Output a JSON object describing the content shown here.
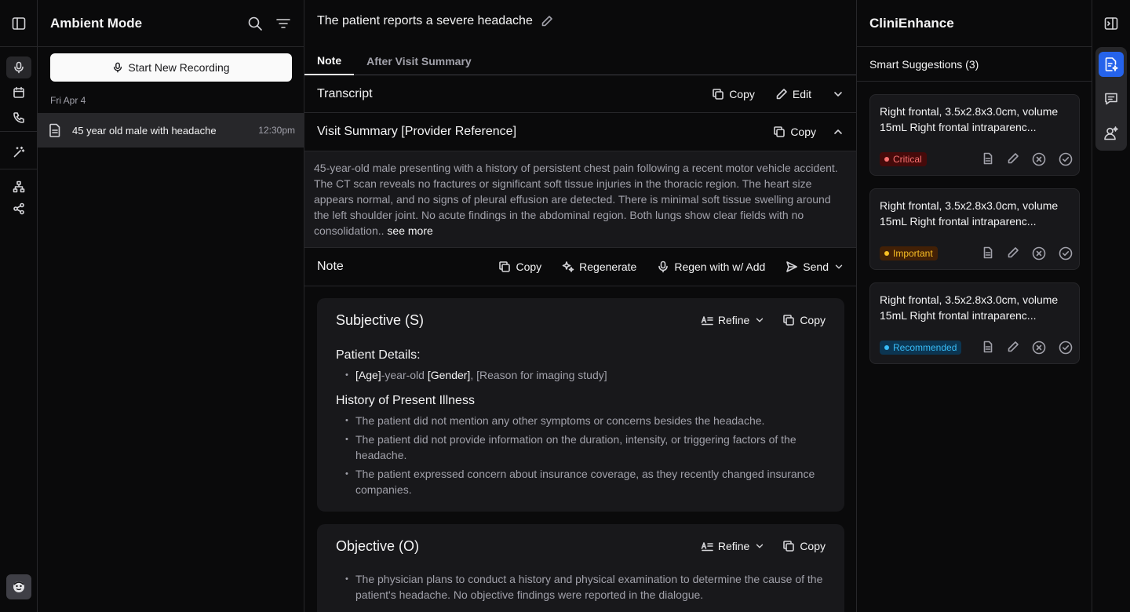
{
  "sessions": {
    "title": "Ambient Mode",
    "record_button": "Start New Recording",
    "date_group": "Fri Apr 4",
    "items": [
      {
        "name": "45 year old male with headache",
        "time": "12:30pm"
      }
    ]
  },
  "note": {
    "title": "The patient reports a severe headache",
    "tabs": [
      {
        "label": "Note"
      },
      {
        "label": "After Visit Summary"
      }
    ],
    "transcript": {
      "label": "Transcript",
      "copy": "Copy",
      "edit": "Edit"
    },
    "visit_summary": {
      "label": "Visit Summary [Provider Reference]",
      "copy": "Copy",
      "text": "45-year-old male presenting with a history of persistent chest pain following a recent motor vehicle accident. The CT scan reveals no fractures or significant soft tissue injuries in the thoracic region. The heart size appears normal, and no signs of pleural effusion are detected. There is minimal soft tissue swelling around the left shoulder joint. No acute findings in the abdominal region. Both lungs show clear fields with no consolidation..",
      "see_more": "see more"
    },
    "note_bar": {
      "label": "Note",
      "copy": "Copy",
      "regenerate": "Regenerate",
      "regen_add": "Regen with w/ Add",
      "send": "Send"
    },
    "subjective": {
      "title": "Subjective (S)",
      "refine": "Refine",
      "copy": "Copy",
      "patient_details_heading": "Patient Details:",
      "pd_age": "[Age]",
      "pd_year_old": "-year-old ",
      "pd_gender": "[Gender]",
      "pd_reason": ", [Reason for imaging study]",
      "hpi_heading": "History of Present Illness",
      "hpi": [
        "The patient did not mention any other symptoms or concerns besides the headache.",
        "The patient did not provide information on the duration, intensity, or triggering factors of the headache.",
        "The patient expressed concern about insurance coverage, as they recently changed insurance companies."
      ]
    },
    "objective": {
      "title": "Objective (O)",
      "refine": "Refine",
      "copy": "Copy",
      "items": [
        "The physician plans to conduct a history and physical examination to determine the cause of the patient's headache. No objective findings were reported in the dialogue."
      ]
    }
  },
  "enhance": {
    "title": "CliniEnhance",
    "suggestions_label": "Smart Suggestions (3)",
    "suggestions": [
      {
        "text": "Right frontal, 3.5x2.8x3.0cm, volume 15mL Right frontal intraparenc...",
        "badge": "Critical",
        "badge_color": "#f87171",
        "badge_bg": "#450a0a"
      },
      {
        "text": "Right frontal, 3.5x2.8x3.0cm, volume 15mL Right frontal intraparenc...",
        "badge": "Important",
        "badge_color": "#fbbf24",
        "badge_bg": "#422006"
      },
      {
        "text": "Right frontal, 3.5x2.8x3.0cm, volume 15mL Right frontal intraparenc...",
        "badge": "Recommended",
        "badge_color": "#38bdf8",
        "badge_bg": "#0c3551"
      }
    ]
  },
  "icons": [
    "sidebar-toggle-icon",
    "mic-icon",
    "calendar-icon",
    "phone-icon",
    "magic-wand-icon",
    "sitemap-icon",
    "share-icon",
    "search-icon",
    "filter-icon",
    "document-icon",
    "pencil-icon",
    "copy-icon",
    "chevron-down-icon",
    "chevron-up-icon",
    "sparkle-icon",
    "send-icon",
    "refine-icon",
    "circle-x-icon",
    "circle-check-icon",
    "doc-sparkle-icon",
    "chat-icon",
    "user-sparkle-icon"
  ],
  "colors": {
    "accent": "#2563eb",
    "bg": "#0a0a0b",
    "card": "#18181b",
    "border": "#27272a"
  }
}
